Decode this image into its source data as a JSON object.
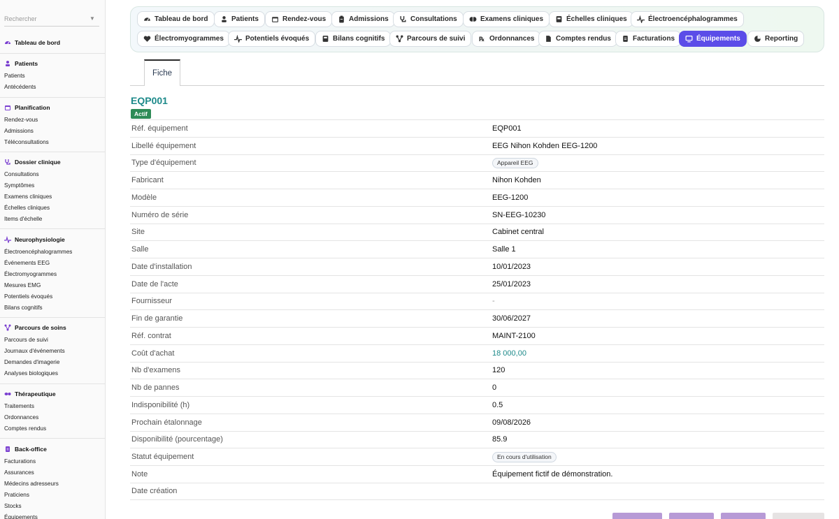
{
  "search": {
    "placeholder": "Rechercher"
  },
  "sidebar": {
    "dashboard": "Tableau de bord",
    "sections": [
      {
        "title": "Patients",
        "icon": "person-icon",
        "items": [
          "Patients",
          "Antécédents"
        ]
      },
      {
        "title": "Planification",
        "icon": "calendar-icon",
        "items": [
          "Rendez-vous",
          "Admissions",
          "Téléconsultations"
        ]
      },
      {
        "title": "Dossier clinique",
        "icon": "stethoscope-icon",
        "items": [
          "Consultations",
          "Symptômes",
          "Examens cliniques",
          "Échelles cliniques",
          "Items d'échelle"
        ]
      },
      {
        "title": "Neurophysiologie",
        "icon": "waveform-icon",
        "items": [
          "Électroencéphalogrammes",
          "Événements EEG",
          "Électromyogrammes",
          "Mesures EMG",
          "Potentiels évoqués",
          "Bilans cognitifs"
        ]
      },
      {
        "title": "Parcours de soins",
        "icon": "route-icon",
        "items": [
          "Parcours de suivi",
          "Journaux d'événements",
          "Demandes d'imagerie",
          "Analyses biologiques"
        ]
      },
      {
        "title": "Thérapeutique",
        "icon": "pills-icon",
        "items": [
          "Traitements",
          "Ordonnances",
          "Comptes rendus"
        ]
      },
      {
        "title": "Back-office",
        "icon": "document-icon",
        "items": [
          "Facturations",
          "Assurances",
          "Médecins adresseurs",
          "Praticiens",
          "Stocks",
          "Équipements"
        ]
      }
    ]
  },
  "tabs": [
    {
      "label": "Tableau de bord",
      "icon": "gauge-icon"
    },
    {
      "label": "Patients",
      "icon": "person-icon"
    },
    {
      "label": "Rendez-vous",
      "icon": "calendar-icon"
    },
    {
      "label": "Admissions",
      "icon": "clipboard-icon"
    },
    {
      "label": "Consultations",
      "icon": "stethoscope-icon"
    },
    {
      "label": "Examens cliniques",
      "icon": "brain-icon"
    },
    {
      "label": "Échelles cliniques",
      "icon": "scale-icon"
    },
    {
      "label": "Électroencéphalogrammes",
      "icon": "waveform-icon"
    },
    {
      "label": "Électromyogrammes",
      "icon": "heart-icon"
    },
    {
      "label": "Potentiels évoqués",
      "icon": "waveform-icon"
    },
    {
      "label": "Bilans cognitifs",
      "icon": "book-icon"
    },
    {
      "label": "Parcours de suivi",
      "icon": "route-icon"
    },
    {
      "label": "Ordonnances",
      "icon": "prescription-icon"
    },
    {
      "label": "Comptes rendus",
      "icon": "file-icon"
    },
    {
      "label": "Facturations",
      "icon": "invoice-icon"
    },
    {
      "label": "Équipements",
      "icon": "monitor-icon",
      "active": true
    },
    {
      "label": "Reporting",
      "icon": "pie-chart-icon"
    }
  ],
  "subtab": {
    "label": "Fiche"
  },
  "record": {
    "id": "EQP001",
    "status": "Actif",
    "fields": [
      {
        "label": "Réf. équipement",
        "value": "EQP001"
      },
      {
        "label": "Libellé équipement",
        "value": "EEG Nihon Kohden EEG-1200"
      },
      {
        "label": "Type d'équipement",
        "value": "Appareil EEG",
        "kind": "chip"
      },
      {
        "label": "Fabricant",
        "value": "Nihon Kohden"
      },
      {
        "label": "Modèle",
        "value": "EEG-1200"
      },
      {
        "label": "Numéro de série",
        "value": "SN-EEG-10230"
      },
      {
        "label": "Site",
        "value": "Cabinet central"
      },
      {
        "label": "Salle",
        "value": "Salle 1"
      },
      {
        "label": "Date d'installation",
        "value": "10/01/2023"
      },
      {
        "label": "Date de l'acte",
        "value": "25/01/2023"
      },
      {
        "label": "Fournisseur",
        "value": "-",
        "kind": "muted"
      },
      {
        "label": "Fin de garantie",
        "value": "30/06/2027"
      },
      {
        "label": "Réf. contrat",
        "value": "MAINT-2100"
      },
      {
        "label": "Coût d'achat",
        "value": "18 000,00",
        "kind": "link"
      },
      {
        "label": "Nb d'examens",
        "value": "120"
      },
      {
        "label": "Nb de pannes",
        "value": "0"
      },
      {
        "label": "Indisponibilité (h)",
        "value": "0.5"
      },
      {
        "label": "Prochain étalonnage",
        "value": "09/08/2026"
      },
      {
        "label": "Disponibilité (pourcentage)",
        "value": "85.9"
      },
      {
        "label": "Statut équipement",
        "value": "En cours d'utilisation",
        "kind": "chip"
      },
      {
        "label": "Note",
        "value": "Équipement fictif de démonstration."
      },
      {
        "label": "Date création",
        "value": ""
      }
    ]
  },
  "colors": {
    "accent": "#5b4ce8",
    "teal": "#1d8a8a",
    "success": "#2e8b57",
    "sidebar_icon": "#7a3fd0"
  }
}
